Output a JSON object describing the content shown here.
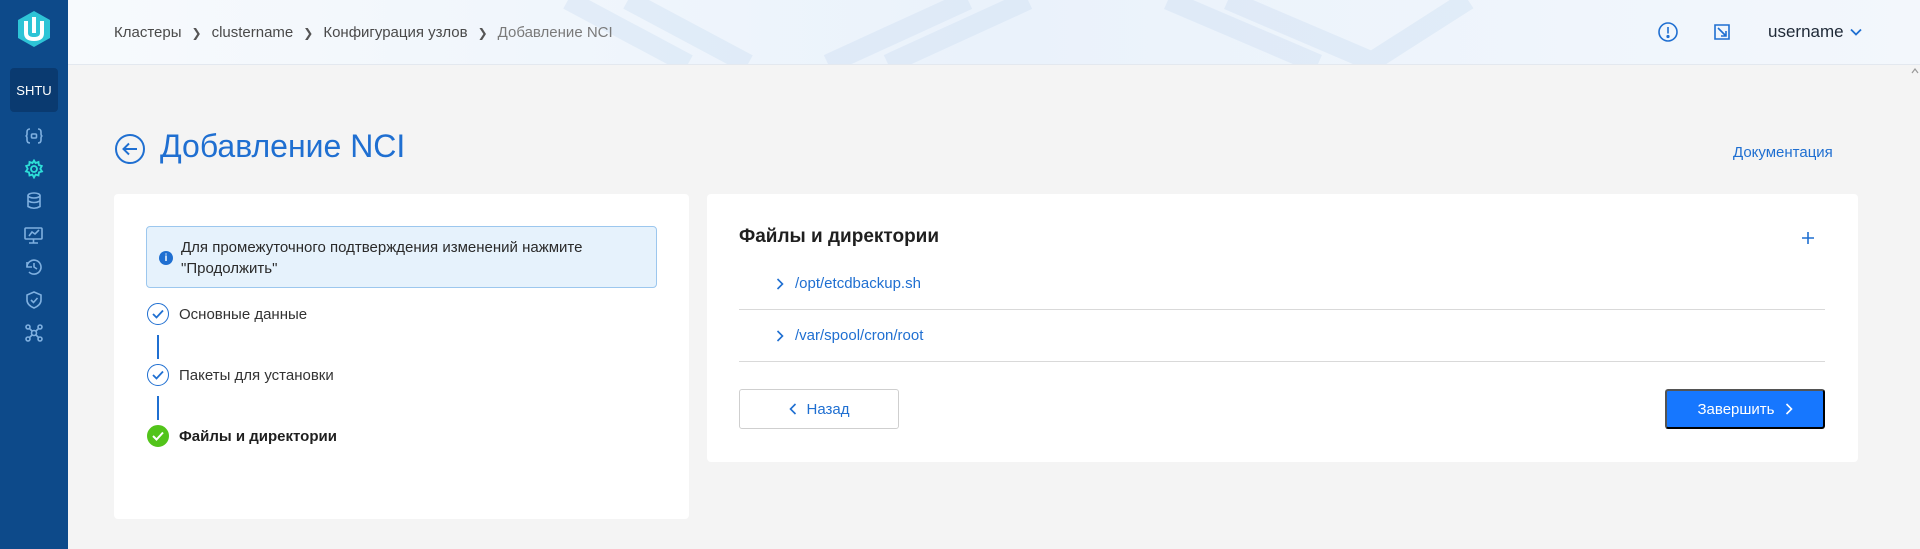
{
  "sidebar": {
    "org_label": "SHTU",
    "items": [
      {
        "icon": "code-braces-icon"
      },
      {
        "icon": "gear-icon"
      },
      {
        "icon": "database-icon"
      },
      {
        "icon": "monitor-icon"
      },
      {
        "icon": "backup-icon"
      },
      {
        "icon": "shield-icon"
      },
      {
        "icon": "network-icon"
      }
    ],
    "accent": "#0d4a8a"
  },
  "header": {
    "breadcrumb": [
      "Кластеры",
      "clustername",
      "Конфигурация узлов",
      "Добавление NCI"
    ],
    "user": "username"
  },
  "page": {
    "title": "Добавление NCI",
    "doc_link": "Документация"
  },
  "wizard": {
    "info": "Для промежуточного подтверждения изменений нажмите \"Продолжить\"",
    "steps": [
      {
        "label": "Основные данные",
        "status": "completed"
      },
      {
        "label": "Пакеты для установки",
        "status": "completed"
      },
      {
        "label": "Файлы и директории",
        "status": "current"
      }
    ]
  },
  "files": {
    "title": "Файлы и директории",
    "items": [
      "/opt/etcdbackup.sh",
      "/var/spool/cron/root"
    ],
    "back_label": "Назад",
    "finish_label": "Завершить"
  },
  "colors": {
    "primary": "#1f6fd1",
    "button": "#1677ff",
    "success": "#52c41a"
  }
}
